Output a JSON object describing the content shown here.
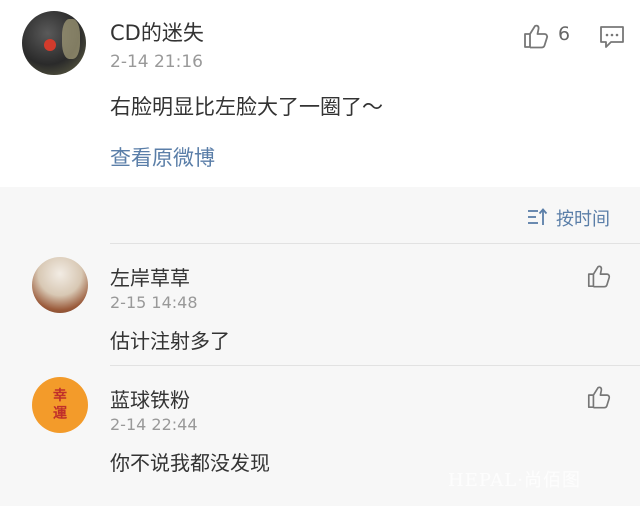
{
  "main_comment": {
    "username": "CD的迷失",
    "timestamp": "2-14 21:16",
    "text": "右脸明显比左脸大了一圈了～",
    "like_count": "6",
    "view_original_label": "查看原微博"
  },
  "sort": {
    "label": "按时间"
  },
  "replies": [
    {
      "username": "左岸草草",
      "timestamp": "2-15 14:48",
      "text": "估计注射多了"
    },
    {
      "username": "蓝球铁粉",
      "timestamp": "2-14 22:44",
      "text": "你不说我都没发现",
      "avatar_text": [
        "幸",
        "運"
      ]
    }
  ],
  "watermark": "HEPAL·尚佰图",
  "colors": {
    "link": "#5a7ea8",
    "muted": "#999999",
    "background": "#f7f7f7",
    "avatar_badge": "#f39b2a"
  }
}
